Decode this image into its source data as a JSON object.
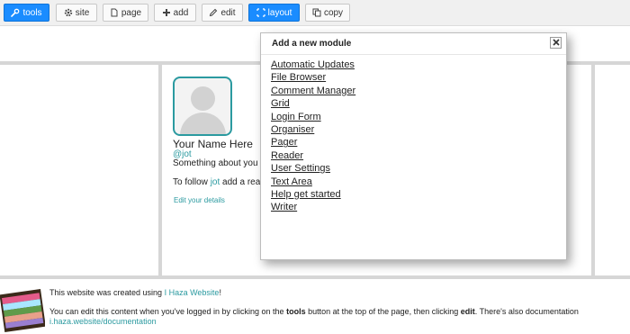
{
  "toolbar": {
    "buttons": [
      {
        "label": "tools",
        "icon": "wrench-icon"
      },
      {
        "label": "site",
        "icon": "gear-icon"
      },
      {
        "label": "page",
        "icon": "page-icon"
      },
      {
        "label": "add",
        "icon": "plus-icon"
      },
      {
        "label": "edit",
        "icon": "pencil-icon"
      },
      {
        "label": "layout",
        "icon": "layout-icon"
      },
      {
        "label": "copy",
        "icon": "copy-icon"
      }
    ],
    "active_color": "#1a8cff"
  },
  "profile": {
    "name": "Your Name Here",
    "handle": "@jot",
    "about": "Something about you",
    "follow_prefix": "To follow",
    "follow_link": "jot",
    "follow_suffix": "add a rea",
    "edit_link": "Edit your details"
  },
  "modal": {
    "title": "Add a new module",
    "close_icon": "close-icon",
    "items": [
      "Automatic Updates",
      "File Browser",
      "Comment Manager",
      "Grid",
      "Login Form",
      "Organiser",
      "Pager",
      "Reader",
      "User Settings",
      "Text Area",
      "Help get started",
      "Writer"
    ]
  },
  "footer": {
    "line1_prefix": "This website was created using",
    "line1_link": "I Haza Website",
    "line1_suffix": "!",
    "line2_a": "You can edit this content when you've logged in by clicking on the",
    "line2_tools": "tools",
    "line2_b": "button at the top of the page, then clicking",
    "line2_edit": "edit",
    "line2_c": ". There's also documentation",
    "line3_link": "i.haza.website/documentation"
  },
  "accent_color": "#2b9aa0"
}
